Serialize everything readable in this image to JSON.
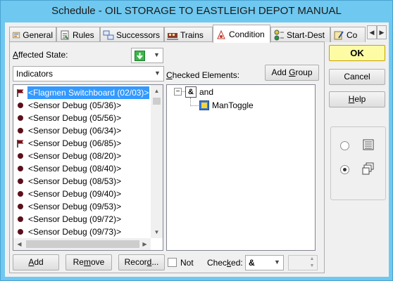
{
  "window": {
    "title": "Schedule - OIL STORAGE TO EASTLEIGH DEPOT MANUAL"
  },
  "tabs": [
    {
      "label": "General",
      "icon": "general-icon"
    },
    {
      "label": "Rules",
      "icon": "rules-icon"
    },
    {
      "label": "Successors",
      "icon": "successors-icon"
    },
    {
      "label": "Trains",
      "icon": "trains-icon"
    },
    {
      "label": "Condition",
      "icon": "condition-icon",
      "active": true
    },
    {
      "label": "Start-Dest",
      "icon": "start-dest-icon"
    },
    {
      "label": "Co",
      "icon": "comments-icon"
    }
  ],
  "affected_state": {
    "label": "Affected State:",
    "accel": "A",
    "value_icon": "green-down-arrow-icon"
  },
  "category_combo": {
    "value": "Indicators"
  },
  "checked_elements": {
    "label": "Checked Elements:",
    "accel": "C"
  },
  "add_group": {
    "label": "Add Group",
    "accel": "G"
  },
  "indicator_list": [
    {
      "text": "<Flagmen Switchboard (02/03)>",
      "icon": "flag-icon",
      "selected": true
    },
    {
      "text": "<Sensor Debug (05/36)>",
      "icon": "dot-icon"
    },
    {
      "text": "<Sensor Debug (05/56)>",
      "icon": "dot-icon"
    },
    {
      "text": "<Sensor Debug (06/34)>",
      "icon": "dot-icon"
    },
    {
      "text": "<Sensor Debug (06/85)>",
      "icon": "flag-icon"
    },
    {
      "text": "<Sensor Debug (08/20)>",
      "icon": "dot-icon"
    },
    {
      "text": "<Sensor Debug (08/40)>",
      "icon": "dot-icon"
    },
    {
      "text": "<Sensor Debug (08/53)>",
      "icon": "dot-icon"
    },
    {
      "text": "<Sensor Debug (09/40)>",
      "icon": "dot-icon"
    },
    {
      "text": "<Sensor Debug (09/53)>",
      "icon": "dot-icon"
    },
    {
      "text": "<Sensor Debug (09/72)>",
      "icon": "dot-icon"
    },
    {
      "text": "<Sensor Debug (09/73)>",
      "icon": "dot-icon"
    }
  ],
  "tree": {
    "root": {
      "label": "and",
      "badge": "&"
    },
    "children": [
      {
        "label": "ManToggle",
        "icon": "toggle-icon"
      }
    ]
  },
  "bottom": {
    "add": {
      "label": "Add",
      "accel": "A"
    },
    "remove": {
      "label": "Remove",
      "accel": "m"
    },
    "record": {
      "label": "Record...",
      "accel": "d"
    },
    "not_label": "Not",
    "checked_label": "Checked:",
    "checked_accel": "k",
    "checked_value": "&"
  },
  "side_buttons": {
    "ok": "OK",
    "cancel": "Cancel",
    "help": "Help",
    "help_accel": "H"
  },
  "view_options": [
    {
      "icon": "list-view-icon",
      "checked": false
    },
    {
      "icon": "cascade-view-icon",
      "checked": true
    }
  ]
}
